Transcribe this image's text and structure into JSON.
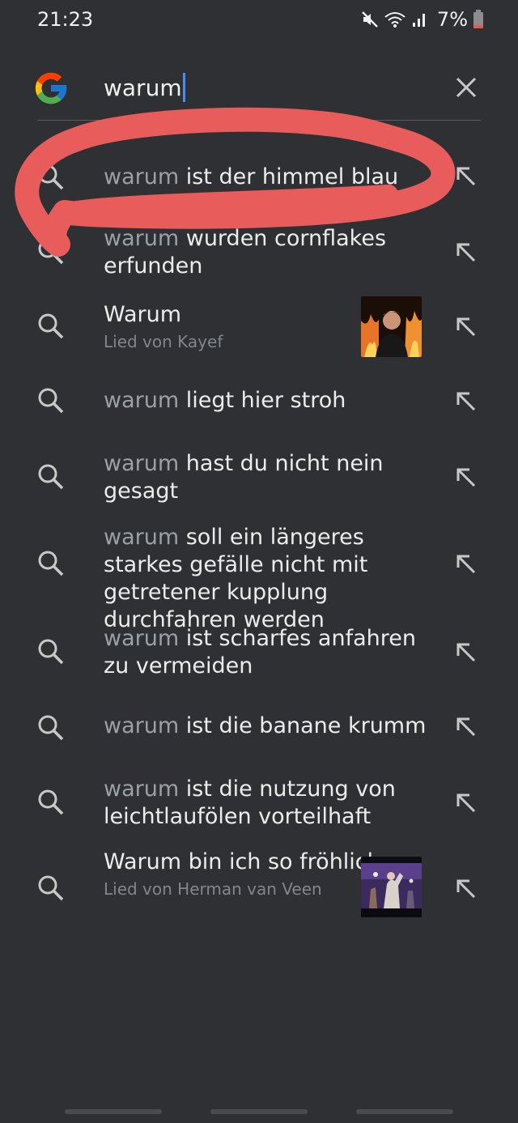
{
  "status_bar": {
    "time": "21:23",
    "battery": "7%",
    "battery_color": "#e85a4f"
  },
  "search": {
    "query": "warum",
    "accent_color": "#4c8bf5"
  },
  "suggestions": [
    {
      "match": "warum",
      "rest": " ist der himmel blau",
      "subtitle": ""
    },
    {
      "match": "warum",
      "rest": " wurden cornflakes erfunden",
      "subtitle": ""
    },
    {
      "match": "",
      "rest": "Warum",
      "subtitle": "Lied von Kayef",
      "thumbnail": "album-art-kayef"
    },
    {
      "match": "warum",
      "rest": " liegt hier stroh",
      "subtitle": ""
    },
    {
      "match": "warum",
      "rest": " hast du nicht nein gesagt",
      "subtitle": ""
    },
    {
      "match": "warum",
      "rest": " soll ein längeres starkes gefälle nicht mit getretener kupplung durchfahren werden",
      "subtitle": ""
    },
    {
      "match": "warum",
      "rest": " ist scharfes anfahren zu vermeiden",
      "subtitle": ""
    },
    {
      "match": "warum",
      "rest": " ist die banane krumm",
      "subtitle": ""
    },
    {
      "match": "warum",
      "rest": " ist die nutzung von leichtlaufölen vorteilhaft",
      "subtitle": ""
    },
    {
      "match": "",
      "rest": "Warum bin ich so fröhlich",
      "subtitle": "Lied von Herman van Veen",
      "thumbnail": "album-art-herman-van-veen"
    }
  ],
  "annotation_color": "#e85c5c"
}
